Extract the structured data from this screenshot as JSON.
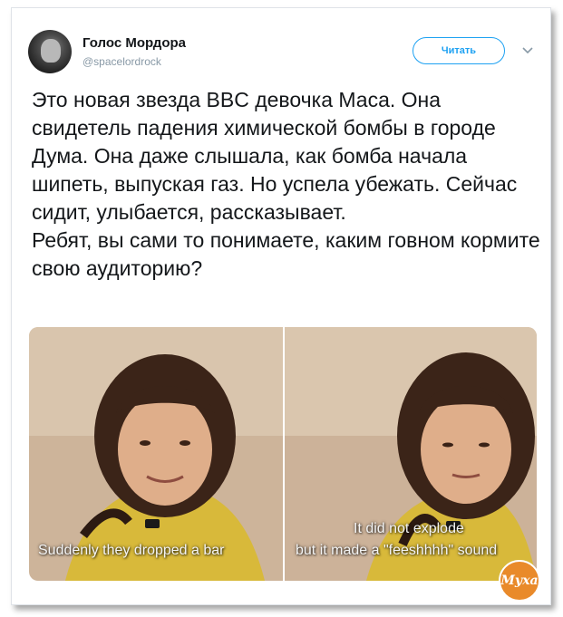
{
  "tweet": {
    "author_name": "Голос Мордора",
    "author_handle": "@spacelordrock",
    "follow_label": "Читать",
    "text": "Это новая звезда BBC девочка Маса. Она свидетель падения химической бомбы в городе Дума. Она даже слышала, как бомба начала шипеть, выпуская газ. Но успела убежать. Сейчас сидит, улыбается, рассказывает.\nРебят, вы сами то понимаете, каким говном кормите свою аудиторию?"
  },
  "media": {
    "left_caption": "Suddenly they dropped a bar",
    "right_caption_line1": "It did not explode",
    "right_caption_line2": "but it made a \"feeshhhh\" sound"
  },
  "watermark": {
    "text": "Муха"
  },
  "colors": {
    "accent": "#1da1f2",
    "text": "#14171a",
    "muted": "#8899a6",
    "watermark": "#e98a2a"
  },
  "icons": {
    "avatar": "user-avatar",
    "menu": "chevron-down-icon"
  }
}
